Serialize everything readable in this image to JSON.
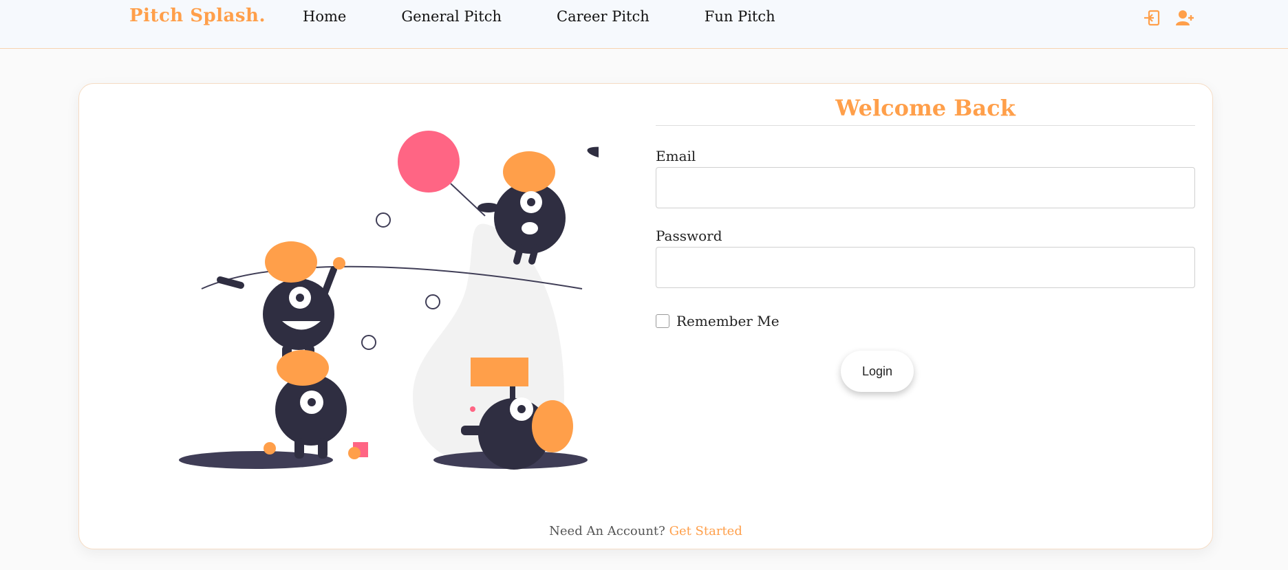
{
  "navbar": {
    "brand": "Pitch Splash.",
    "links": [
      "Home",
      "General Pitch",
      "Career Pitch",
      "Fun Pitch"
    ],
    "icons": [
      "login-icon",
      "add-user-icon"
    ],
    "accent_color": "#ff9f4a"
  },
  "login_form": {
    "title": "Welcome Back",
    "email_label": "Email",
    "email_value": "",
    "password_label": "Password",
    "password_value": "",
    "remember_label": "Remember Me",
    "remember_checked": false,
    "login_button": "Login"
  },
  "signup_prompt": {
    "text": "Need An Account?",
    "link": "Get Started"
  },
  "illustration": {
    "name": "playful-monsters-illustration",
    "colors": {
      "orange": "#ff9f4a",
      "pink": "#ff6584",
      "dark": "#2f2e41",
      "blob": "#f2f2f2"
    }
  }
}
